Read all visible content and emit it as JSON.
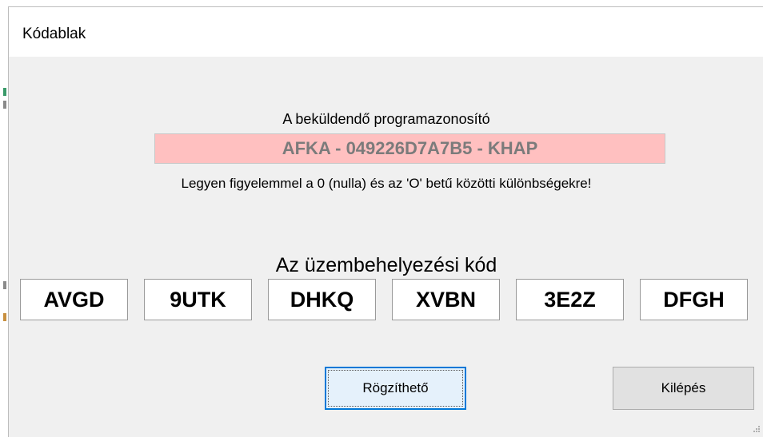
{
  "window": {
    "title": "Kódablak"
  },
  "program_id": {
    "caption": "A beküldendő programazonosító",
    "value": "AFKA - 049226D7A7B5 - KHAP",
    "warning": "Legyen figyelemmel a 0 (nulla) és az 'O' betű közötti különbségekre!"
  },
  "activation": {
    "label": "Az üzembehelyezési kód",
    "codes": [
      "AVGD",
      "9UTK",
      "DHKQ",
      "XVBN",
      "3E2Z",
      "DFGH"
    ]
  },
  "buttons": {
    "save_label": "Rögzíthető",
    "exit_label": "Kilépés"
  },
  "colors": {
    "id_box_background": "#ffc0c0",
    "focus_border": "#0078d7"
  }
}
